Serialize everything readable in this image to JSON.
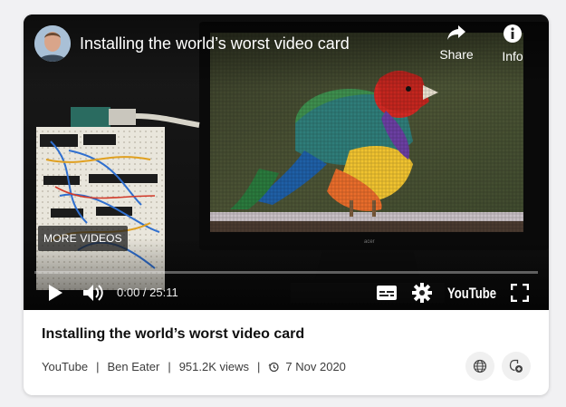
{
  "video": {
    "title": "Installing the world’s worst video card",
    "share_label": "Share",
    "info_label": "Info",
    "more_videos_label": "MORE VIDEOS",
    "time_display": "0:00 / 25:11",
    "progress": 0,
    "youtube_logo": "YouTube",
    "icons": {
      "share": "share-arrow-icon",
      "info": "info-icon",
      "play": "play-icon",
      "volume": "volume-icon",
      "subtitles": "subtitles-icon",
      "settings": "gear-icon",
      "fullscreen": "fullscreen-icon"
    }
  },
  "card": {
    "title": "Installing the world’s worst video card",
    "source": "YouTube",
    "channel": "Ben Eater",
    "views": "951.2K views",
    "date": "7 Nov 2020",
    "separator": "|",
    "icons": {
      "date": "history-icon",
      "globe": "globe-icon",
      "save": "save-to-collection-icon"
    }
  },
  "colors": {
    "page_bg": "#f1f1f3",
    "card_bg": "#ffffff",
    "player_bg": "#101010"
  }
}
